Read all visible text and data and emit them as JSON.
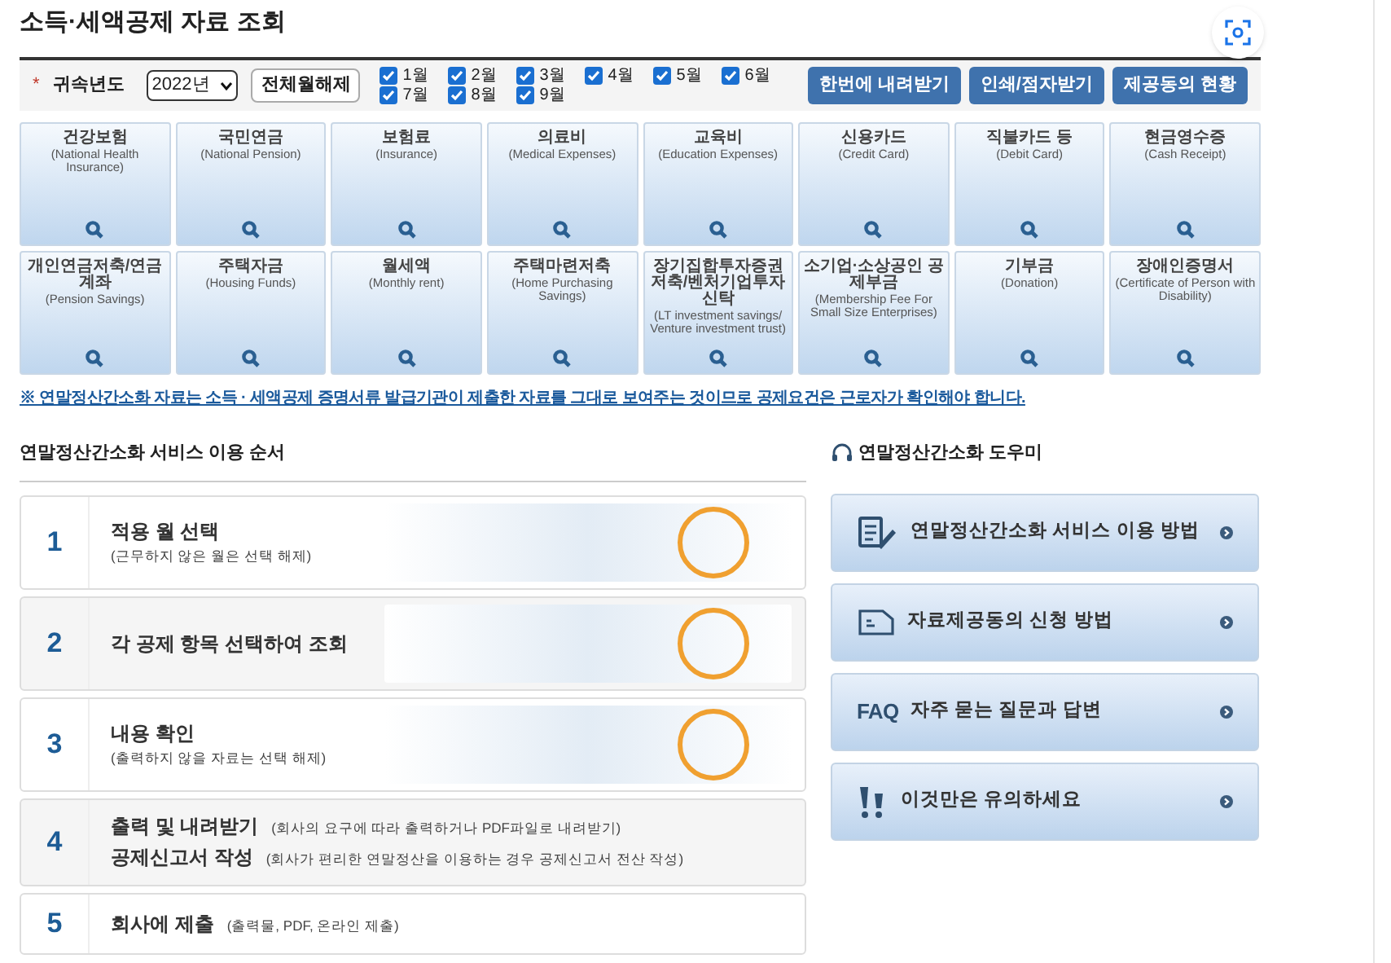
{
  "title": "소득·세액공제 자료 조회",
  "filter": {
    "required_mark": "*",
    "label": "귀속년도",
    "year": "2022년",
    "clear_button": "전체월해제",
    "months": [
      {
        "label": "1월",
        "checked": true
      },
      {
        "label": "2월",
        "checked": true
      },
      {
        "label": "3월",
        "checked": true
      },
      {
        "label": "4월",
        "checked": true
      },
      {
        "label": "5월",
        "checked": true
      },
      {
        "label": "6월",
        "checked": true
      },
      {
        "label": "7월",
        "checked": true
      },
      {
        "label": "8월",
        "checked": true
      },
      {
        "label": "9월",
        "checked": true
      }
    ],
    "buttons": [
      "한번에 내려받기",
      "인쇄/점자받기",
      "제공동의 현황"
    ]
  },
  "categories": [
    {
      "title": "건강보험",
      "subtitle": "(National Health Insurance)"
    },
    {
      "title": "국민연금",
      "subtitle": "(National Pension)"
    },
    {
      "title": "보험료",
      "subtitle": "(Insurance)"
    },
    {
      "title": "의료비",
      "subtitle": "(Medical Expenses)"
    },
    {
      "title": "교육비",
      "subtitle": "(Education Expenses)"
    },
    {
      "title": "신용카드",
      "subtitle": "(Credit Card)"
    },
    {
      "title": "직불카드 등",
      "subtitle": "(Debit Card)"
    },
    {
      "title": "현금영수증",
      "subtitle": "(Cash Receipt)"
    },
    {
      "title": "개인연금저축/연금계좌",
      "subtitle": "(Pension Savings)"
    },
    {
      "title": "주택자금",
      "subtitle": "(Housing Funds)"
    },
    {
      "title": "월세액",
      "subtitle": "(Monthly rent)"
    },
    {
      "title": "주택마련저축",
      "subtitle": "(Home Purchasing Savings)"
    },
    {
      "title": "장기집합투자증권저축/벤처기업투자신탁",
      "subtitle": "(LT investment savings/ Venture investment trust)"
    },
    {
      "title": "소기업·소상공인 공제부금",
      "subtitle": "(Membership Fee For Small Size Enterprises)"
    },
    {
      "title": "기부금",
      "subtitle": "(Donation)"
    },
    {
      "title": "장애인증명서",
      "subtitle": "(Certificate of Person with Disability)"
    }
  ],
  "notice": "※ 연말정산간소화 자료는 소득 · 세액공제 증명서류 발급기관이 제출한 자료를 그대로 보여주는 것이므로 공제요건은 근로자가 확인해야 합니다.",
  "steps": {
    "heading": "연말정산간소화 서비스 이용 순서",
    "items": [
      {
        "number": "1",
        "lines": [
          {
            "title": "적용 월 선택",
            "note": "(근무하지 않은 월은 선택 해제)"
          }
        ],
        "kind": "stacked"
      },
      {
        "number": "2",
        "lines": [
          {
            "title": "각 공제 항목 선택하여 조회"
          }
        ],
        "kind": "stacked"
      },
      {
        "number": "3",
        "lines": [
          {
            "title": "내용 확인",
            "note": "(출력하지 않을 자료는 선택 해제)"
          }
        ],
        "kind": "stacked"
      },
      {
        "number": "4",
        "lines": [
          {
            "title": "출력 및 내려받기",
            "note": "(회사의 요구에 따라 출력하거나 PDF파일로 내려받기)"
          },
          {
            "title": "공제신고서 작성",
            "note": "(회사가 편리한 연말정산을 이용하는 경우 공제신고서 전산 작성)"
          }
        ],
        "kind": "inline"
      },
      {
        "number": "5",
        "lines": [
          {
            "title": "회사에 제출",
            "note": "(출력물, PDF, 온라인 제출)"
          }
        ],
        "kind": "inline"
      }
    ]
  },
  "help": {
    "heading": "연말정산간소화 도우미",
    "items": [
      {
        "kind": "edit",
        "label": "연말정산간소화 서비스 이용 방법"
      },
      {
        "kind": "form",
        "label": "자료제공동의 신청 방법"
      },
      {
        "kind": "text",
        "icon_text": "FAQ",
        "label": "자주 묻는 질문과 답변"
      },
      {
        "kind": "alert",
        "label": "이것만은 유의하세요"
      }
    ]
  }
}
